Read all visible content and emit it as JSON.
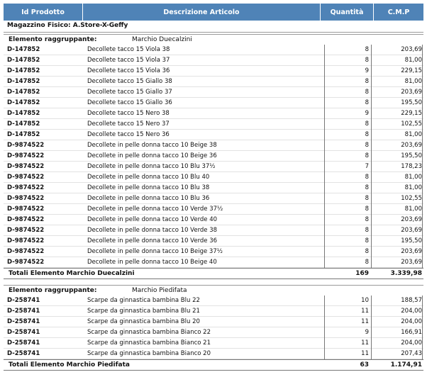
{
  "header": {
    "id": "Id Prodotto",
    "desc": "Descrizione Articolo",
    "qty": "Quantità",
    "cmp": "C.M.P"
  },
  "magazzino": "Magazzino Fisico: A.Store-X-Geffy",
  "groups": [
    {
      "label": "Elemento raggruppante:",
      "value": "Marchio Duecalzini",
      "rows": [
        {
          "id": "D-147852",
          "desc": "Decollete tacco 15 Viola 38",
          "qty": "8",
          "cmp": "203,69"
        },
        {
          "id": "D-147852",
          "desc": "Decollete tacco 15 Viola 37",
          "qty": "8",
          "cmp": "81,00"
        },
        {
          "id": "D-147852",
          "desc": "Decollete tacco 15 Viola 36",
          "qty": "9",
          "cmp": "229,15"
        },
        {
          "id": "D-147852",
          "desc": "Decollete tacco 15 Giallo 38",
          "qty": "8",
          "cmp": "81,00"
        },
        {
          "id": "D-147852",
          "desc": "Decollete tacco 15 Giallo 37",
          "qty": "8",
          "cmp": "203,69"
        },
        {
          "id": "D-147852",
          "desc": "Decollete tacco 15 Giallo 36",
          "qty": "8",
          "cmp": "195,50"
        },
        {
          "id": "D-147852",
          "desc": "Decollete tacco 15 Nero 38",
          "qty": "9",
          "cmp": "229,15"
        },
        {
          "id": "D-147852",
          "desc": "Decollete tacco 15 Nero 37",
          "qty": "8",
          "cmp": "102,55"
        },
        {
          "id": "D-147852",
          "desc": "Decollete tacco 15 Nero 36",
          "qty": "8",
          "cmp": "81,00"
        },
        {
          "id": "D-9874522",
          "desc": "Decollete in pelle donna tacco 10 Beige 38",
          "qty": "8",
          "cmp": "203,69"
        },
        {
          "id": "D-9874522",
          "desc": "Decollete in pelle donna tacco 10 Beige 36",
          "qty": "8",
          "cmp": "195,50"
        },
        {
          "id": "D-9874522",
          "desc": "Decollete in pelle donna tacco 10 Blu 37½",
          "qty": "7",
          "cmp": "178,23"
        },
        {
          "id": "D-9874522",
          "desc": "Decollete in pelle donna tacco 10 Blu 40",
          "qty": "8",
          "cmp": "81,00"
        },
        {
          "id": "D-9874522",
          "desc": "Decollete in pelle donna tacco 10 Blu 38",
          "qty": "8",
          "cmp": "81,00"
        },
        {
          "id": "D-9874522",
          "desc": "Decollete in pelle donna tacco 10 Blu 36",
          "qty": "8",
          "cmp": "102,55"
        },
        {
          "id": "D-9874522",
          "desc": "Decollete in pelle donna tacco 10 Verde 37½",
          "qty": "8",
          "cmp": "81,00"
        },
        {
          "id": "D-9874522",
          "desc": "Decollete in pelle donna tacco 10 Verde 40",
          "qty": "8",
          "cmp": "203,69"
        },
        {
          "id": "D-9874522",
          "desc": "Decollete in pelle donna tacco 10 Verde 38",
          "qty": "8",
          "cmp": "203,69"
        },
        {
          "id": "D-9874522",
          "desc": "Decollete in pelle donna tacco 10 Verde 36",
          "qty": "8",
          "cmp": "195,50"
        },
        {
          "id": "D-9874522",
          "desc": "Decollete in pelle donna tacco 10 Beige 37½",
          "qty": "8",
          "cmp": "203,69"
        },
        {
          "id": "D-9874522",
          "desc": "Decollete in pelle donna tacco 10 Beige 40",
          "qty": "8",
          "cmp": "203,69"
        }
      ],
      "total": {
        "label": "Totali Elemento Marchio Duecalzini",
        "qty": "169",
        "cmp": "3.339,98"
      }
    },
    {
      "label": "Elemento raggruppante:",
      "value": "Marchio Piedifata",
      "rows": [
        {
          "id": "D-258741",
          "desc": "Scarpe da ginnastica bambina Blu 22",
          "qty": "10",
          "cmp": "188,57"
        },
        {
          "id": "D-258741",
          "desc": "Scarpe da ginnastica bambina Blu 21",
          "qty": "11",
          "cmp": "204,00"
        },
        {
          "id": "D-258741",
          "desc": "Scarpe da ginnastica bambina Blu 20",
          "qty": "11",
          "cmp": "204,00"
        },
        {
          "id": "D-258741",
          "desc": "Scarpe da ginnastica bambina Bianco 22",
          "qty": "9",
          "cmp": "166,91"
        },
        {
          "id": "D-258741",
          "desc": "Scarpe da ginnastica bambina Bianco 21",
          "qty": "11",
          "cmp": "204,00"
        },
        {
          "id": "D-258741",
          "desc": "Scarpe da ginnastica bambina Bianco 20",
          "qty": "11",
          "cmp": "207,43"
        }
      ],
      "total": {
        "label": "Totali Elemento Marchio Piedifata",
        "qty": "63",
        "cmp": "1.174,91"
      }
    }
  ]
}
